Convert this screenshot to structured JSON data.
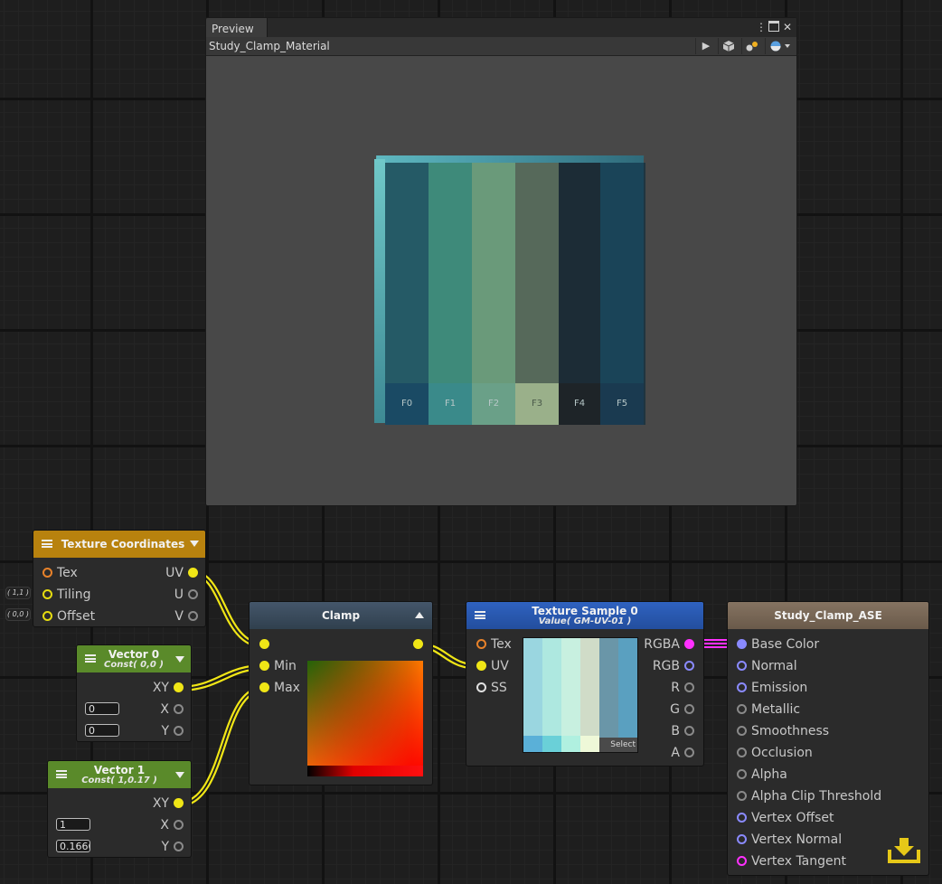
{
  "preview": {
    "tab_label": "Preview",
    "material_name": "Study_Clamp_Material",
    "tiles": [
      "F0",
      "F1",
      "F2",
      "F3",
      "F4",
      "F5"
    ]
  },
  "texture_coordinates": {
    "title": "Texture Coordinates",
    "inputs": [
      "Tex",
      "Tiling",
      "Offset"
    ],
    "outputs": [
      "UV",
      "U",
      "V"
    ],
    "tiling_chip": "( 1,1 )",
    "offset_chip": "( 0,0 )"
  },
  "vector0": {
    "title": "Vector 0",
    "subtitle": "Const( 0,0 )",
    "out": "XY",
    "x_label": "X",
    "y_label": "Y",
    "x_value": "0",
    "y_value": "0"
  },
  "vector1": {
    "title": "Vector 1",
    "subtitle": "Const( 1,0.17 )",
    "out": "XY",
    "x_label": "X",
    "y_label": "Y",
    "x_value": "1",
    "y_value": "0.1666"
  },
  "clamp": {
    "title": "Clamp",
    "inputs": [
      "Min",
      "Max"
    ]
  },
  "texture_sample": {
    "title": "Texture Sample 0",
    "subtitle": "Value( GM-UV-01 )",
    "inputs": [
      "Tex",
      "UV",
      "SS"
    ],
    "outputs": [
      "RGBA",
      "RGB",
      "R",
      "G",
      "B",
      "A"
    ],
    "select_label": "Select"
  },
  "output_node": {
    "title": "Study_Clamp_ASE",
    "inputs": [
      "Base Color",
      "Normal",
      "Emission",
      "Metallic",
      "Smoothness",
      "Occlusion",
      "Alpha",
      "Alpha Clip Threshold",
      "Vertex Offset",
      "Vertex Normal",
      "Vertex Tangent"
    ]
  },
  "colors": {
    "tc_header": "#b8820e",
    "vector_header": "#5a8a2a",
    "clamp_header": "#3a4a5a",
    "ts_header": "#2a5ab0",
    "out_header": "#7a6a58",
    "wire_yellow": "#f0e616",
    "wire_magenta": "#ff30ff"
  }
}
